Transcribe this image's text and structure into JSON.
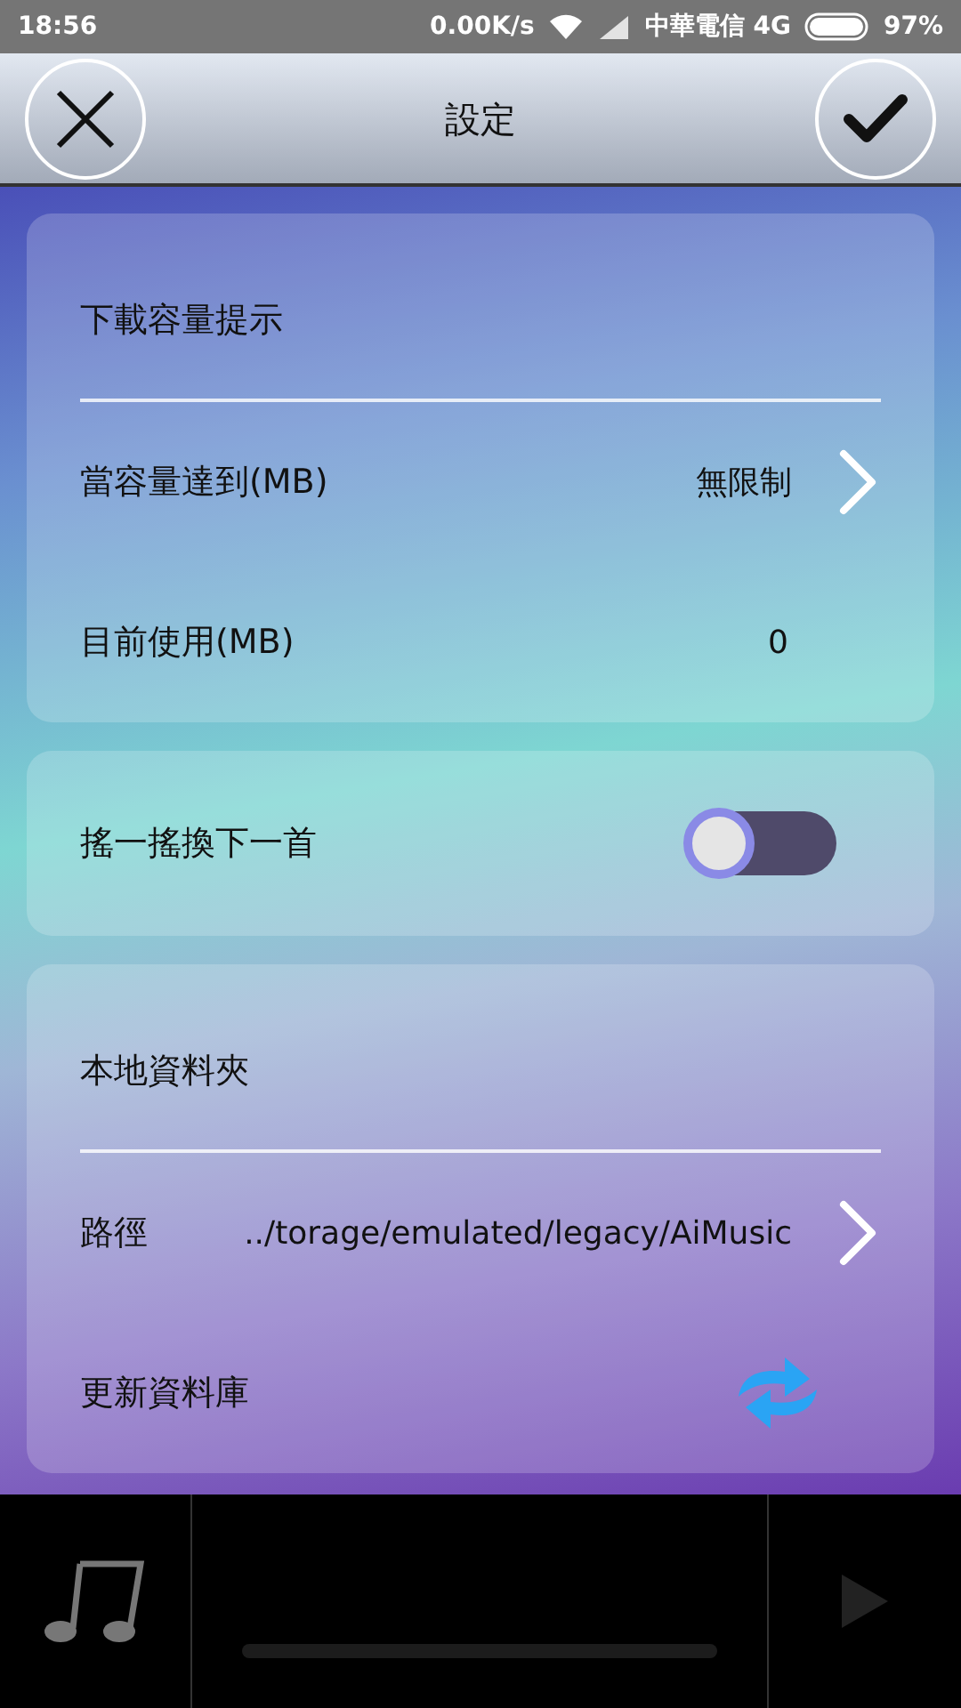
{
  "status_bar": {
    "time": "18:56",
    "speed": "0.00K/s",
    "carrier": "中華電信 4G",
    "battery": "97%"
  },
  "header": {
    "title": "設定"
  },
  "sections": [
    {
      "title": "下載容量提示",
      "rows": [
        {
          "kind": "link",
          "label": "當容量達到(MB)",
          "value": "無限制"
        },
        {
          "kind": "value",
          "label": "目前使用(MB)",
          "value": "0"
        }
      ]
    },
    {
      "rows": [
        {
          "kind": "toggle",
          "label": "搖一搖換下一首",
          "on": false
        }
      ]
    },
    {
      "title": "本地資料夾",
      "rows": [
        {
          "kind": "link",
          "label": "路徑",
          "value": "../torage/emulated/legacy/AiMusic"
        },
        {
          "kind": "action",
          "label": "更新資料庫"
        }
      ]
    }
  ],
  "player": {
    "progress": {
      "level": 0
    }
  }
}
